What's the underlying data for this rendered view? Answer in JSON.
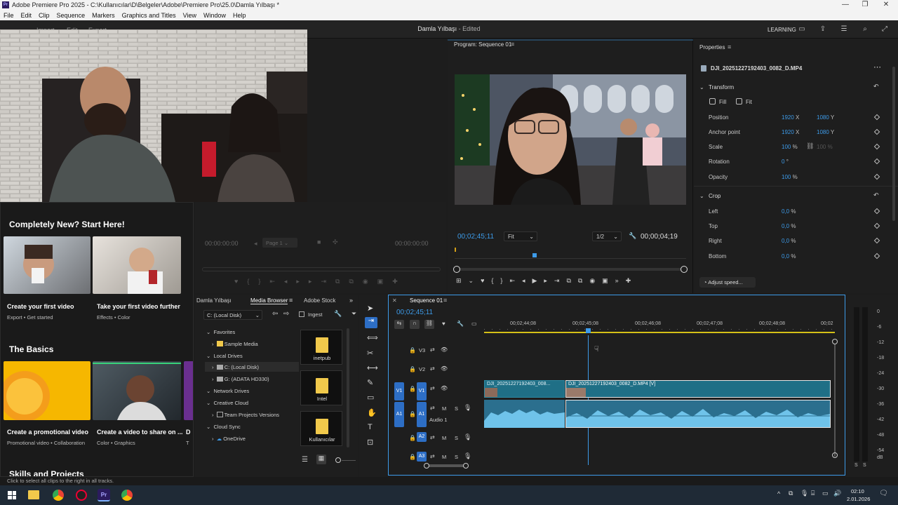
{
  "window": {
    "title": "Adobe Premiere Pro 2025 - C:\\Kullanıcılar\\D\\Belgeler\\Adobe\\Premiere Pro\\25.0\\Damla Yılbaşı *"
  },
  "menu": [
    "File",
    "Edit",
    "Clip",
    "Sequence",
    "Markers",
    "Graphics and Titles",
    "View",
    "Window",
    "Help"
  ],
  "header": {
    "tabs": [
      "Import",
      "Edit",
      "Export"
    ],
    "project_title": "Damla Yılbaşı",
    "project_status": "- Edited",
    "learning": "LEARNING"
  },
  "source_monitor": {
    "timecode_in": "00:00:00:00",
    "page": "Page 1",
    "timecode_out": "00:00:00:00"
  },
  "program_monitor": {
    "title": "Program: Sequence 01",
    "timecode": "00;02;45;11",
    "fit": "Fit",
    "resolution": "1/2",
    "duration": "00;00;04;19"
  },
  "properties": {
    "title": "Properties",
    "clip_name": "DJI_20251227192403_0082_D.MP4",
    "transform_label": "Transform",
    "fill": "Fill",
    "fit": "Fit",
    "position_label": "Position",
    "position_x": "1920",
    "position_y": "1080",
    "anchor_label": "Anchor point",
    "anchor_x": "1920",
    "anchor_y": "1080",
    "scale_label": "Scale",
    "scale_val": "100",
    "scale_val2": "100 %",
    "rotation_label": "Rotation",
    "rotation_val": "0",
    "rotation_unit": "°",
    "opacity_label": "Opacity",
    "opacity_val": "100",
    "crop_label": "Crop",
    "left_label": "Left",
    "left_val": "0,0",
    "top_label": "Top",
    "top_val": "0,0",
    "right_label": "Right",
    "right_val": "0,0",
    "bottom_label": "Bottom",
    "bottom_val": "0,0",
    "unit_x": "X",
    "unit_y": "Y",
    "unit_pct": "%",
    "adjust_speed": "Adjust speed..."
  },
  "learn": {
    "section1": "Completely New? Start Here!",
    "cards1": [
      {
        "title": "Create your first video",
        "sub": "Export  •  Get started"
      },
      {
        "title": "Take your first video further",
        "sub": "Effects  •  Color"
      }
    ],
    "section2": "The Basics",
    "cards2": [
      {
        "title": "Create a promotional video",
        "sub": "Promotional video  •  Collaboration"
      },
      {
        "title": "Create a video to share on ...",
        "sub": "Color  •  Graphics"
      },
      {
        "title": "D",
        "sub": "T"
      }
    ],
    "section3": "Skills and Projects"
  },
  "media_browser": {
    "tabs": [
      "Damla Yılbaşı",
      "Media Browser",
      "Adobe Stock"
    ],
    "location": "C: (Local Disk)",
    "ingest": "Ingest",
    "tree": [
      {
        "label": "Favorites",
        "level": 0,
        "open": true
      },
      {
        "label": "Sample Media",
        "level": 1,
        "icon": "folder"
      },
      {
        "label": "Local Drives",
        "level": 0,
        "open": true
      },
      {
        "label": "C: (Local Disk)",
        "level": 1,
        "icon": "drive",
        "selected": true
      },
      {
        "label": "G: (ADATA HD330)",
        "level": 1,
        "icon": "drive"
      },
      {
        "label": "Network Drives",
        "level": 0,
        "open": true
      },
      {
        "label": "Creative Cloud",
        "level": 0,
        "open": true
      },
      {
        "label": "Team Projects Versions",
        "level": 1,
        "icon": "team"
      },
      {
        "label": "Cloud Sync",
        "level": 0,
        "open": true
      },
      {
        "label": "OneDrive",
        "level": 1,
        "icon": "cloud"
      }
    ],
    "folders": [
      "inetpub",
      "Intel",
      "Kullanıcılar"
    ]
  },
  "timeline": {
    "title": "Sequence 01",
    "timecode": "00;02;45;11",
    "ruler": [
      "00;02;44;08",
      "00;02;45;08",
      "00;02;46;08",
      "00;02;47;08",
      "00;02;48;08",
      "00;02"
    ],
    "tracks": {
      "v3": "V3",
      "v2": "V2",
      "v1": "V1",
      "v1_src": "V1",
      "a1": "A1",
      "a1_src": "A1",
      "a2": "A2",
      "a3": "A3",
      "audio1": "Audio 1",
      "m": "M",
      "s": "S"
    },
    "clip1": "DJI_20251227192403_008...",
    "clip2": "DJI_20251227192403_0082_D.MP4 [V]"
  },
  "meter": {
    "scale": [
      "0",
      "-6",
      "-12",
      "-18",
      "-24",
      "-30",
      "-36",
      "-42",
      "-48",
      "-54"
    ],
    "db": "dB",
    "solo": [
      "S",
      "S"
    ]
  },
  "status": "Click to select all clips to the right in all tracks.",
  "taskbar": {
    "time": "02:10",
    "date": "2.01.2026"
  },
  "colors": {
    "accent": "#3d9be9",
    "track_blue": "#2d6ec5",
    "video_clip": "#1f6f86",
    "audio_clip": "#3b8fb0",
    "panel": "#1e1e1e"
  }
}
